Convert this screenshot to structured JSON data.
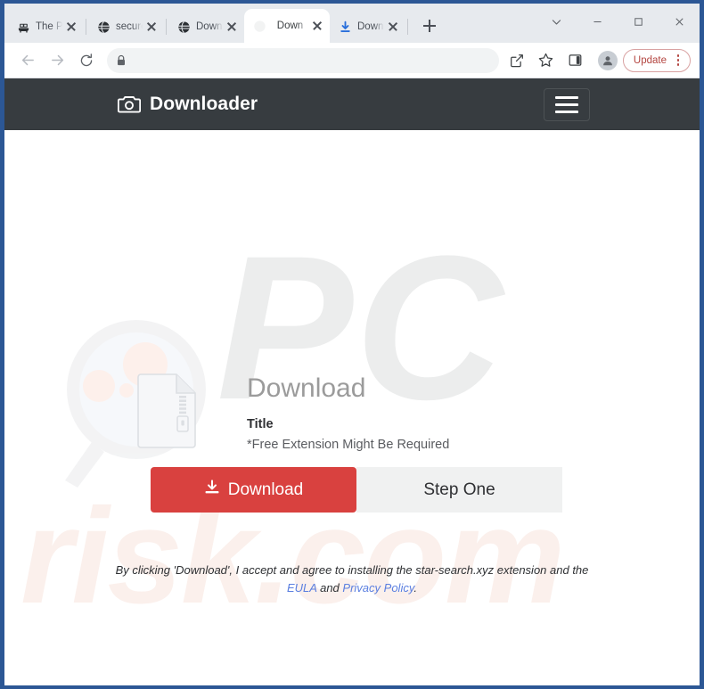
{
  "browser": {
    "tabs": [
      {
        "title": "The Pi",
        "favicon": "pirate-ship-icon",
        "active": false
      },
      {
        "title": "secure",
        "favicon": "globe-icon",
        "active": false
      },
      {
        "title": "Down",
        "favicon": "globe-icon",
        "active": false
      },
      {
        "title": "Down",
        "favicon": "faded-favicon",
        "active": true
      },
      {
        "title": "Down",
        "favicon": "download-icon",
        "active": false
      }
    ],
    "new_tab_label": "+",
    "window_controls": {
      "tab_search": "chevron-down-icon",
      "minimize": "minimize-icon",
      "maximize": "maximize-icon",
      "close": "close-icon"
    },
    "toolbar": {
      "back": "back-arrow-icon",
      "forward": "forward-arrow-icon",
      "reload": "reload-icon",
      "lock": "lock-icon",
      "url_value": "",
      "url_placeholder": "",
      "share": "share-icon",
      "bookmark": "star-icon",
      "side_panel": "side-panel-icon",
      "profile": "avatar-icon",
      "update_label": "Update",
      "menu": "three-dot-menu-icon"
    }
  },
  "site": {
    "brand": {
      "icon": "camera-icon",
      "name": "Downloader"
    },
    "menu_toggle": "hamburger-menu-icon",
    "hero": {
      "file_icon": "zip-file-icon",
      "magnifier_icon": "magnifier-icon",
      "title": "Download",
      "subtitle": "Title",
      "note": "*Free Extension Might Be Required"
    },
    "actions": {
      "download_label": "Download",
      "download_icon": "download-arrow-icon",
      "step_label": "Step One"
    },
    "disclaimer": {
      "lead": "By clicking 'Download', I accept and agree to installing the star-search.xyz extension and the",
      "eula_label": "EULA",
      "conjunction": "and",
      "privacy_label": "Privacy Policy",
      "period": "."
    },
    "watermark": {
      "top": "PC",
      "bottom": "risk.com"
    },
    "colors": {
      "header_bg": "#373c40",
      "accent_red": "#d9413f",
      "step_bg": "#f0f1f1",
      "link_blue": "#5b7fe0",
      "window_border": "#2c5795"
    }
  }
}
